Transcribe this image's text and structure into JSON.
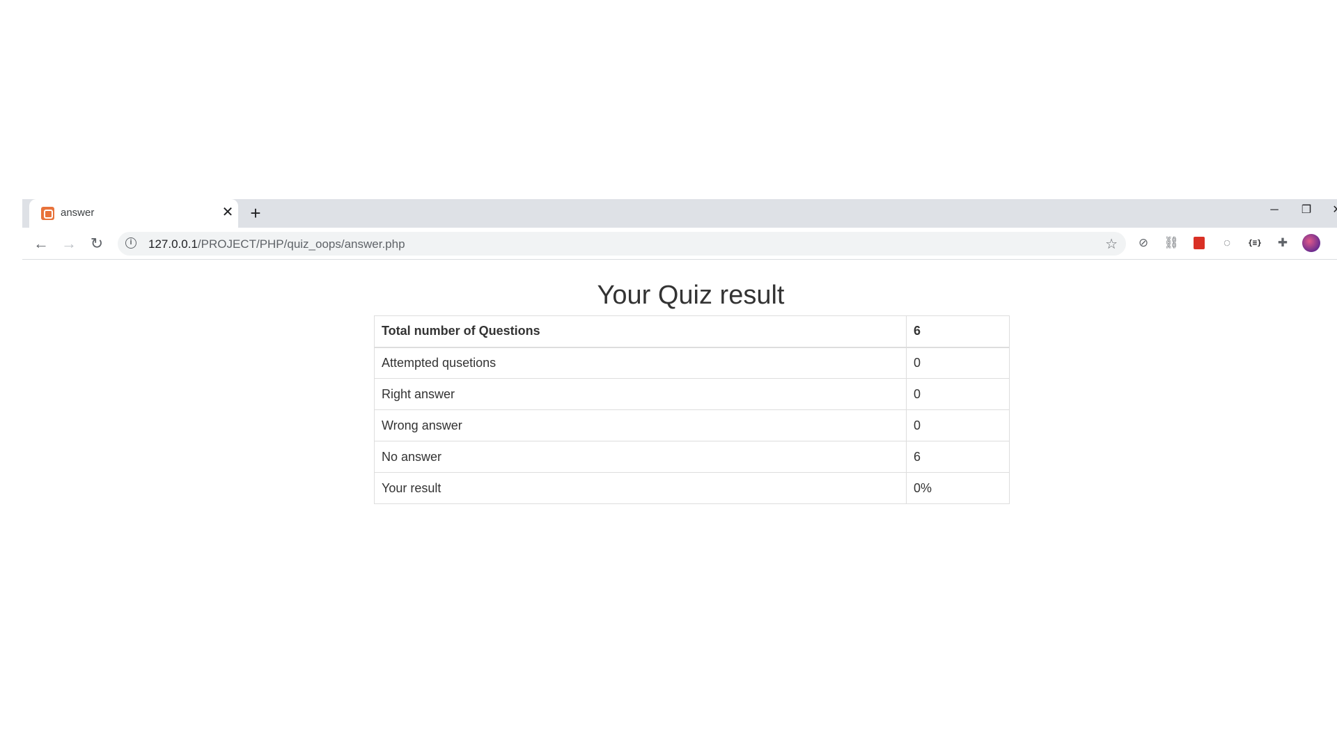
{
  "browser": {
    "tab": {
      "title": "answer",
      "favicon": "xampp-icon"
    },
    "toolbar": {
      "url_host": "127.0.0.1",
      "url_path": "/PROJECT/PHP/quiz_oops/answer.php"
    }
  },
  "page": {
    "title": "Your Quiz result",
    "table": {
      "header": {
        "label": "Total number of Questions",
        "value": "6"
      },
      "rows": [
        {
          "label": "Attempted qusetions",
          "value": "0"
        },
        {
          "label": "Right answer",
          "value": "0"
        },
        {
          "label": "Wrong answer",
          "value": "0"
        },
        {
          "label": "No answer",
          "value": "6"
        },
        {
          "label": "Your result",
          "value": "0%"
        }
      ]
    }
  },
  "colors": {
    "tabstrip_bg": "#dee1e6",
    "omnibox_bg": "#f1f3f4",
    "favicon": "#e8733b",
    "table_border": "#dddddd"
  }
}
